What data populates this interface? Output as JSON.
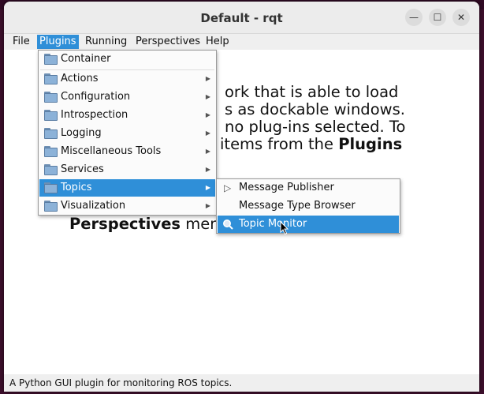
{
  "window": {
    "title": "Default - rqt",
    "minimize_glyph": "—",
    "maximize_glyph": "☐",
    "close_glyph": "✕"
  },
  "menubar": {
    "items": [
      {
        "label": "File"
      },
      {
        "label": "Plugins"
      },
      {
        "label": "Running"
      },
      {
        "label": "Perspectives"
      },
      {
        "label": "Help"
      }
    ]
  },
  "welcome": {
    "line1": "ork that is able to load",
    "line2": "s as dockable windows.",
    "line3": "no plug-ins selected. To",
    "line4_pre": "items from the ",
    "line4_bold": "Plugins",
    "line5_bold": "Perspectives",
    "line5_rest": " men"
  },
  "plugins_menu": {
    "items": [
      {
        "label": "Container",
        "submenu": false
      },
      {
        "label": "Actions",
        "submenu": true
      },
      {
        "label": "Configuration",
        "submenu": true
      },
      {
        "label": "Introspection",
        "submenu": true
      },
      {
        "label": "Logging",
        "submenu": true
      },
      {
        "label": "Miscellaneous Tools",
        "submenu": true
      },
      {
        "label": "Services",
        "submenu": true
      },
      {
        "label": "Topics",
        "submenu": true,
        "selected": true
      },
      {
        "label": "Visualization",
        "submenu": true
      }
    ]
  },
  "topics_menu": {
    "items": [
      {
        "label": "Message Publisher",
        "icon": "play-icon"
      },
      {
        "label": "Message Type Browser",
        "icon": ""
      },
      {
        "label": "Topic Monitor",
        "icon": "search-icon",
        "selected": true
      }
    ]
  },
  "status": {
    "text": "A Python GUI plugin for monitoring ROS topics."
  },
  "colors": {
    "accent": "#2f8fd8",
    "terminal": "#300a24"
  }
}
